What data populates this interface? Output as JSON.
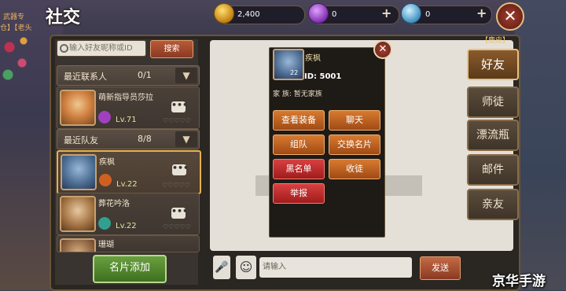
{
  "header": {
    "title": "社交",
    "subtitle_line1": "武器专",
    "subtitle_line2": "仓】【老头"
  },
  "currencies": [
    {
      "icon": "gold-coin-icon",
      "value": "2,400",
      "color": "#d4a020"
    },
    {
      "icon": "purple-gem-icon",
      "value": "0",
      "color": "#a040c0"
    },
    {
      "icon": "diamond-icon",
      "value": "0",
      "color": "#60b0e0"
    }
  ],
  "plus_glyph": "+",
  "close_glyph": "✕",
  "search": {
    "placeholder": "输入好友昵称或ID",
    "button": "搜索"
  },
  "recent_contacts": {
    "label": "最近联系人",
    "count": "0/1",
    "entries": [
      {
        "name": "萌新指导员莎拉",
        "level": "Lv.71",
        "badge_color": "#a040c0",
        "hearts": "♡♡♡♡♡"
      }
    ]
  },
  "recent_team": {
    "label": "最近队友",
    "count": "8/8",
    "entries": [
      {
        "name": "疾枫",
        "level": "Lv.22",
        "badge_color": "#d06020",
        "hearts": "♡♡♡♡♡",
        "selected": true
      },
      {
        "name": "葬花吟洛",
        "level": "Lv.22",
        "badge_color": "#30a090",
        "hearts": "♡♡♡♡♡"
      },
      {
        "name": "珊瑚",
        "level": "",
        "badge_color": "#806040",
        "hearts": ""
      }
    ]
  },
  "more_glyph": "•••",
  "add_card_button": "名片添加",
  "popup": {
    "name": "疾枫",
    "avatar_level": "22",
    "id_text": "ID: 5001",
    "family_text": "家 族: 暂无家族",
    "actions": [
      {
        "label": "查看装备",
        "style": "orange"
      },
      {
        "label": "聊天",
        "style": "orange"
      },
      {
        "label": "组队",
        "style": "orange"
      },
      {
        "label": "交换名片",
        "style": "orange"
      },
      {
        "label": "黑名单",
        "style": "red"
      },
      {
        "label": "收徒",
        "style": "orange"
      },
      {
        "label": "举报",
        "style": "red"
      }
    ]
  },
  "chat": {
    "mic_icon": "microphone-icon",
    "emoji_icon": "smiley-icon",
    "input_placeholder": "请输入",
    "send_button": "发送"
  },
  "side_tabs": [
    {
      "label": "好友",
      "active": true
    },
    {
      "label": "师徒",
      "active": false
    },
    {
      "label": "漂流瓶",
      "active": false
    },
    {
      "label": "邮件",
      "active": false
    },
    {
      "label": "亲友",
      "active": false
    }
  ],
  "deer_label": "【鹿皮】",
  "watermark": "京华手游"
}
